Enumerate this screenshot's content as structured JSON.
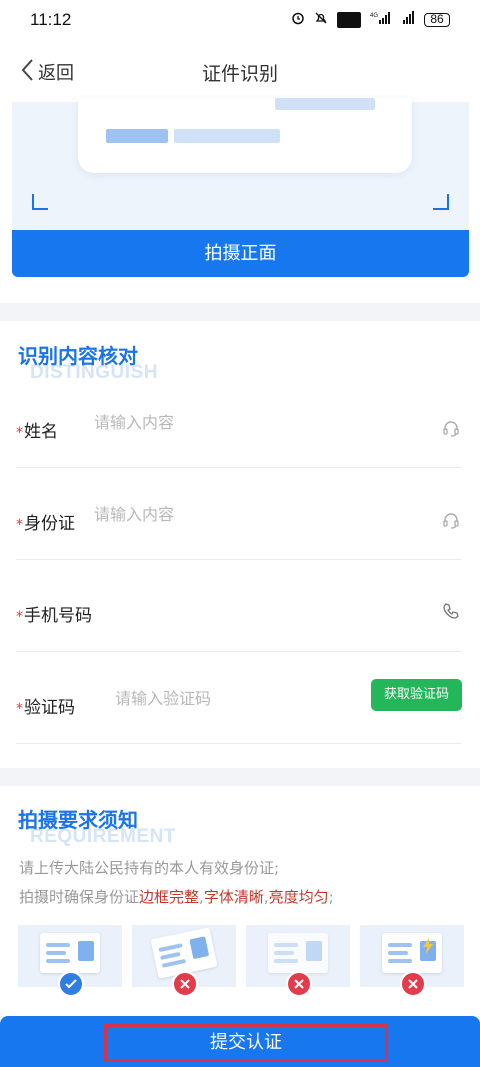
{
  "status_bar": {
    "time": "11:12",
    "network": "4G",
    "hd": "HD",
    "battery": "86"
  },
  "nav": {
    "back_label": "返回",
    "title": "证件识别"
  },
  "capture": {
    "button_label": "拍摄正面"
  },
  "verify_section": {
    "title": "识别内容核对",
    "bg_text": "DISTINGUISH",
    "fields": [
      {
        "label": "姓名",
        "placeholder": "请输入内容",
        "required": "*",
        "icon": "headset-icon"
      },
      {
        "label": "身份证",
        "placeholder": "请输入内容",
        "required": "*",
        "icon": "headset-icon"
      },
      {
        "label": "手机号码",
        "placeholder": "",
        "required": "*",
        "icon": "phone-icon"
      },
      {
        "label": "验证码",
        "placeholder": "请输入验证码",
        "required": "*",
        "button": "获取验证码"
      }
    ]
  },
  "requirement_section": {
    "title": "拍摄要求须知",
    "bg_text": "REQUIREMENT",
    "line1": "请上传大陆公民持有的本人有效身份证;",
    "line2_prefix": "拍摄时确保身份证",
    "line2_hl1": "边框完整",
    "line2_sep1": ",",
    "line2_hl2": "字体清晰",
    "line2_sep2": ",",
    "line2_hl3": "亮度均匀",
    "line2_suffix": ";",
    "samples": [
      "check-icon",
      "cross-icon",
      "cross-icon",
      "cross-icon"
    ]
  },
  "submit": {
    "label": "提交认证"
  },
  "colors": {
    "primary": "#1677ee",
    "success": "#24b75a",
    "danger": "#e23b4b",
    "required": "#e53935"
  }
}
